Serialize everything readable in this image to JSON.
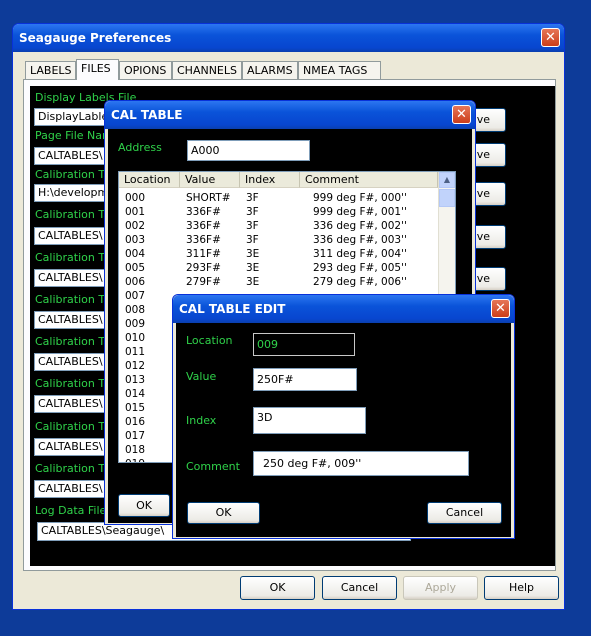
{
  "prefs": {
    "title": "Seagauge Preferences",
    "tabs": [
      "LABELS",
      "FILES",
      "OPIONS",
      "CHANNELS",
      "ALARMS",
      "NMEA TAGS"
    ],
    "fields": [
      {
        "label": "Display Labels File",
        "value": "DisplayLables"
      },
      {
        "label": "Page File Nam",
        "value": "CALTABLES\\"
      },
      {
        "label": "Calibration Tab",
        "value": "H:\\developme"
      },
      {
        "label": "Calibration Tab",
        "value": "CALTABLES\\"
      },
      {
        "label": "Calibration Tab",
        "value": "CALTABLES\\"
      },
      {
        "label": "Calibration Tab",
        "value": "CALTABLES\\"
      },
      {
        "label": "Calibration Tab",
        "value": "CALTABLES\\"
      },
      {
        "label": "Calibration Tab",
        "value": "CALTABLES\\"
      },
      {
        "label": "Calibration Tab",
        "value": "CALTABLES\\"
      },
      {
        "label": "Calibration Tab",
        "value": "CALTABLES\\"
      }
    ],
    "save_labels": [
      "ave",
      "ave",
      "ave",
      "ave",
      "ave"
    ],
    "log_label": "Log Data File",
    "log_value": "CALTABLES\\Seagauge\\",
    "buttons": {
      "ok": "OK",
      "cancel": "Cancel",
      "apply": "Apply",
      "help": "Help"
    }
  },
  "caltable": {
    "title": "CAL TABLE",
    "address_label": "Address",
    "address_value": "A000",
    "columns": [
      "Location",
      "Value",
      "Index",
      "Comment"
    ],
    "rows": [
      {
        "location": "000",
        "value": "SHORT#",
        "index": "3F",
        "comment": "999 deg F#, 000''"
      },
      {
        "location": "001",
        "value": "336F#",
        "index": "3F",
        "comment": "999 deg F#, 001''"
      },
      {
        "location": "002",
        "value": "336F#",
        "index": "3F",
        "comment": "336 deg F#, 002''"
      },
      {
        "location": "003",
        "value": "336F#",
        "index": "3F",
        "comment": "336 deg F#, 003''"
      },
      {
        "location": "004",
        "value": "311F#",
        "index": "3E",
        "comment": "311 deg F#, 004''"
      },
      {
        "location": "005",
        "value": "293F#",
        "index": "3E",
        "comment": "293 deg F#, 005''"
      },
      {
        "location": "006",
        "value": "279F#",
        "index": "3E",
        "comment": "279 deg F#, 006''"
      },
      {
        "location": "007",
        "value": "",
        "index": "",
        "comment": ""
      },
      {
        "location": "008",
        "value": "",
        "index": "",
        "comment": ""
      },
      {
        "location": "009",
        "value": "",
        "index": "",
        "comment": ""
      },
      {
        "location": "010",
        "value": "",
        "index": "",
        "comment": ""
      },
      {
        "location": "011",
        "value": "",
        "index": "",
        "comment": ""
      },
      {
        "location": "012",
        "value": "",
        "index": "",
        "comment": ""
      },
      {
        "location": "013",
        "value": "",
        "index": "",
        "comment": ""
      },
      {
        "location": "014",
        "value": "",
        "index": "",
        "comment": ""
      },
      {
        "location": "015",
        "value": "",
        "index": "",
        "comment": ""
      },
      {
        "location": "016",
        "value": "",
        "index": "",
        "comment": ""
      },
      {
        "location": "017",
        "value": "",
        "index": "",
        "comment": ""
      },
      {
        "location": "018",
        "value": "",
        "index": "",
        "comment": ""
      },
      {
        "location": "019",
        "value": "",
        "index": "",
        "comment": ""
      }
    ],
    "ok": "OK"
  },
  "edit": {
    "title": "CAL TABLE EDIT",
    "location_label": "Location",
    "location_value": "009",
    "value_label": "Value",
    "value_value": "250F#",
    "index_label": "Index",
    "index_value": "3D",
    "comment_label": "Comment",
    "comment_value": "250 deg F#, 009''",
    "ok": "OK",
    "cancel": "Cancel"
  }
}
